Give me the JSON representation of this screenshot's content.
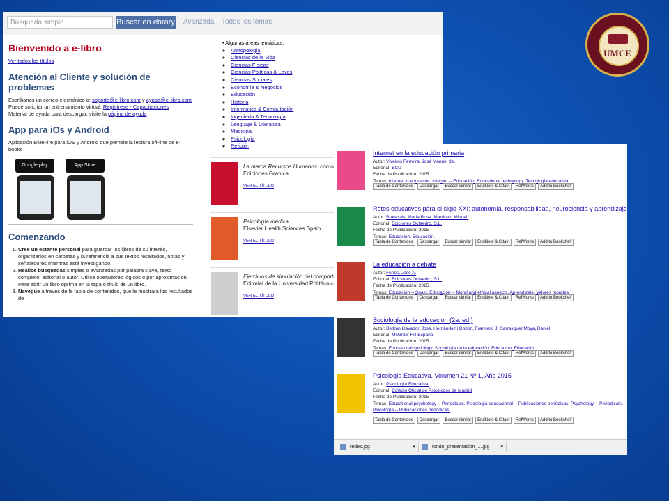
{
  "seal": {
    "text": "UMCE"
  },
  "left": {
    "search_placeholder": "Búsqueda simple",
    "search_button": "Buscar en ebrary",
    "nav": [
      "Avanzada",
      "Todos los temas"
    ],
    "welcome_title": "Bienvenido a e-libro",
    "see_all": "Ver todos los títulos",
    "support_title": "Atención al Cliente y solución de problemas",
    "support_line1_pre": "Escríbanos un correo electrónico a:",
    "support_email1": "soporte@e-libro.com",
    "support_and": "y",
    "support_email2": "ayuda@e-libro.com",
    "support_line2_pre": "Puede solicitar un entrenamiento virtual:",
    "support_training": "Regístrese - Capacitaciones",
    "support_line3_pre": "Material de ayuda para descargar, visite la",
    "support_help_page": "página de ayuda",
    "app_title": "App para iOs y Android",
    "app_text": "Aplicación BlueFire para iOS y Android que permite la lectura off-line de e-books",
    "google_play": "Google play",
    "app_store": "App Store",
    "start_title": "Comenzando",
    "steps": [
      {
        "bold": "Cree un estante personal",
        "text": " para guardar los libros de su interés, organizarlos en carpetas y la referencia a sus textos resaltados, notas y señaladores mientras está investigando."
      },
      {
        "bold": "Realice búsquedas",
        "text": " simples o avanzadas por palabra clave, texto completo, editorial o autor. Utilice operadores lógicos o por aproximación. Para abrir un libro oprima en la tapa o título de un libro."
      },
      {
        "bold": "Navegue",
        "text": " a través de la tabla de contenidos, que le mostrará los resultados de"
      }
    ],
    "areas_label": "Algunas áreas temáticas:",
    "areas": [
      "Antropología",
      "Ciencias de la Vida",
      "Ciencias Físicas",
      "Ciencias Políticas & Leyes",
      "Ciencias Sociales",
      "Economía & Negocios",
      "Educación",
      "Historia",
      "Informática & Computación",
      "Ingeniería & Tecnología",
      "Lenguaje & Literatura",
      "Medicina",
      "Psicología",
      "Religión"
    ],
    "books": [
      {
        "title": "La marca Recursos Humanos: cómo lograr",
        "publisher": "Ediciones Granica",
        "link": "VER EL TÍTULO",
        "cover_color": "#c8102e"
      },
      {
        "title": "Psicología médica",
        "publisher": "Elsevier Health Sciences Spain",
        "link": "VER EL TÍTULO",
        "cover_color": "#e05a2a"
      },
      {
        "title": "Ejercicios de simulación del comportamiento",
        "publisher": "Editorial de la Universidad Politécnica de",
        "link": "VER EL TÍTULO",
        "cover_color": "#cfcfcf"
      }
    ]
  },
  "right": {
    "labels": {
      "author": "Autor:",
      "publisher": "Editorial:",
      "date": "Fecha de Publicación:",
      "topics": "Temas:"
    },
    "buttons": [
      "Tabla de Contenidos",
      "Descargar",
      "Buscar similar",
      "EndNote & Citavi",
      "RefWorks",
      "Add to Bookshelf"
    ],
    "results": [
      {
        "title": "Internet en la educación primaria",
        "authors": "Viveiros Ferreira, José Manuel de.",
        "publisher": "ECU",
        "date": "2015",
        "topics": "Internet in education.  Internet -- Educación.  Educational technology.  Tecnología educativa.",
        "cover_color": "#e84a8a"
      },
      {
        "title": "Retos educativos para el siglo XXI: autonomía, responsabilidad, neurociencia y aprendizaje",
        "authors": "Buxarrais, María Rosa.  Martínez, Miquel.",
        "publisher": "Ediciones Octaedro, S.L.",
        "date": "2015",
        "topics": "Educación.  Educación.",
        "cover_color": "#1a8a4a"
      },
      {
        "title": "La educación a debate",
        "authors": "Funes, José A.",
        "publisher": "Ediciones Octaedro, S.L.",
        "date": "2015",
        "topics": "Educación -- Spain.  Educación -- Moral and ethical aspects.  Aprendizaje.  Valores morales.",
        "cover_color": "#c0392b"
      },
      {
        "title": "Sociología de la educación (2a. ed.)",
        "authors": "Beltrán Llavador, José.  Hernàndez i Dobon, Francesc J.  Carrasquer Moya, Daniel.",
        "publisher": "McGraw-Hill España",
        "date": "2015",
        "topics": "Educational sociology.  Sociología de la educación.  Education.  Educación.",
        "cover_color": "#333333"
      },
      {
        "title": "Psicología Educativa. Volumen 21 Nº 1, Año 2015",
        "authors": "Psicología Educativa.",
        "publisher": "Colegio Oficial de Psicólogos de Madrid",
        "date": "2015",
        "topics": "Educational psychology -- Periodicals.  Psicología educacional -- Publicaciones periódicas.  Psychology -- Periodicals.  Psicología -- Publicaciones periódicas.",
        "cover_color": "#f2c400"
      }
    ],
    "downloads": [
      "redes.jpg",
      "fondo_presentacion_....jpg"
    ]
  }
}
